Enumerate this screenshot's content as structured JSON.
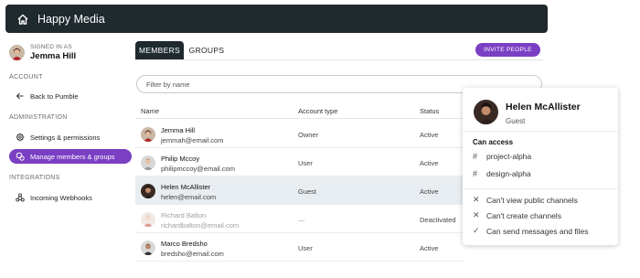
{
  "app": {
    "title": "Happy Media"
  },
  "sidebar": {
    "signed_in_label": "SIGNED IN AS",
    "user_name": "Jemma Hill",
    "sections": {
      "account": "ACCOUNT",
      "administration": "ADMINISTRATION",
      "integrations": "INTEGRATIONS"
    },
    "items": {
      "back": "Back to Pumble",
      "settings": "Settings & permissions",
      "manage": "Manage members & groups",
      "webhooks": "Incoming Webhooks"
    }
  },
  "tabs": {
    "members": "MEMBERS",
    "groups": "GROUPS"
  },
  "invite_label": "INVITE PEOPLE",
  "filter": {
    "placeholder": "Filter by name"
  },
  "table": {
    "headers": {
      "name": "Name",
      "account_type": "Account type",
      "status": "Status"
    },
    "rows": [
      {
        "name": "Jemma Hill",
        "email": "jemmah@email.com",
        "account_type": "Owner",
        "status": "Active"
      },
      {
        "name": "Philip Mccoy",
        "email": "philipmccoy@email.com",
        "account_type": "User",
        "status": "Active"
      },
      {
        "name": "Helen McAllister",
        "email": "helen@email.com",
        "account_type": "Guest",
        "status": "Active"
      },
      {
        "name": "Richard Balton",
        "email": "richardbalton@email.com",
        "account_type": "—",
        "status": "Deactivated"
      },
      {
        "name": "Marco Bredsho",
        "email": "bredsho@email.com",
        "account_type": "User",
        "status": "Active"
      }
    ]
  },
  "card": {
    "name": "Helen McAllister",
    "role": "Guest",
    "can_access_label": "Can access",
    "channels": [
      "project-alpha",
      "design-alpha"
    ],
    "permissions": [
      {
        "icon": "x-icon",
        "text": "Can't view public channels"
      },
      {
        "icon": "x-icon",
        "text": "Can't create channels"
      },
      {
        "icon": "check-icon",
        "text": "Can send messages and files"
      }
    ]
  },
  "colors": {
    "accent": "#7b3fc4",
    "topbar": "#1f2a2f",
    "highlight_row": "#e8edf1"
  }
}
